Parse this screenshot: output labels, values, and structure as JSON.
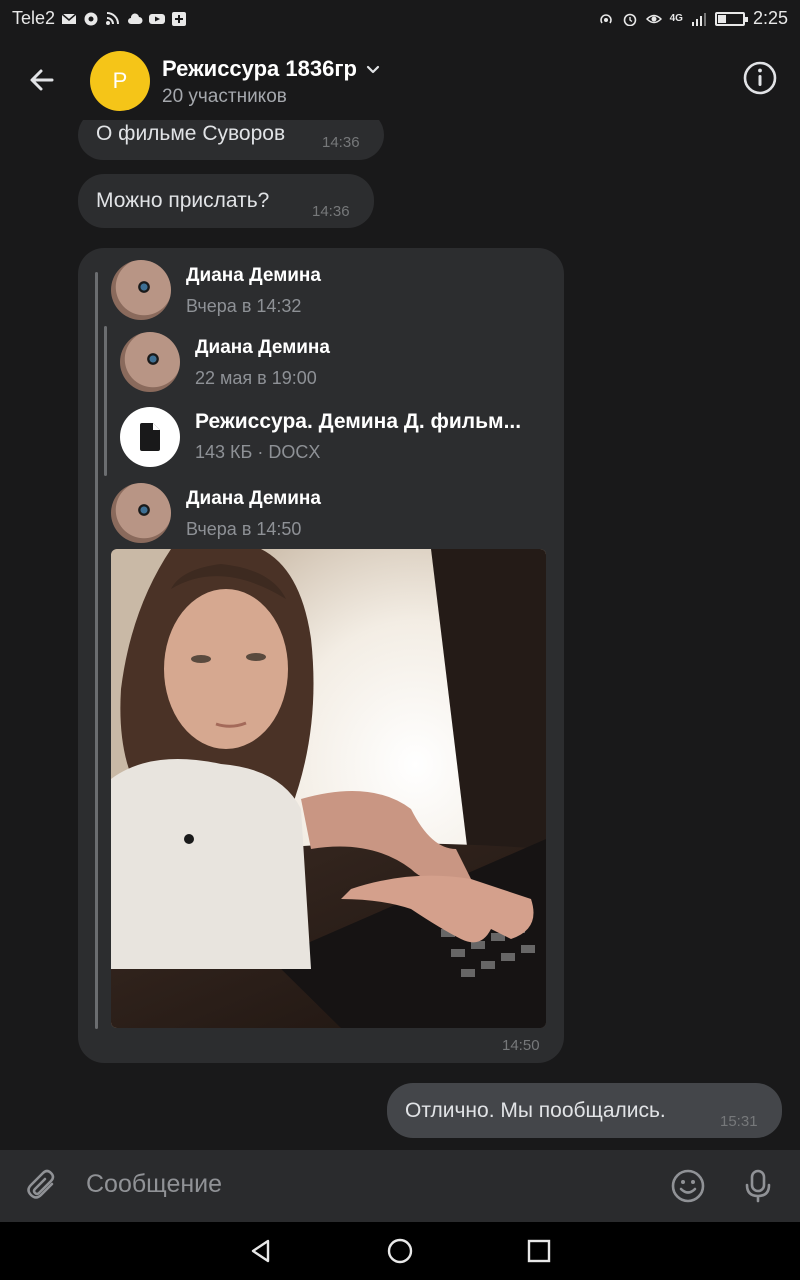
{
  "status_bar": {
    "carrier": "Tele2",
    "time": "2:25",
    "network": "4G",
    "battery_level": 0.35
  },
  "header": {
    "avatar_letter": "Р",
    "avatar_color": "#f5c518",
    "title": "Режиссура 1836гр",
    "subtitle": "20 участников"
  },
  "messages": [
    {
      "text": "О фильме Суворов",
      "time": "14:36"
    },
    {
      "text": "Можно прислать?",
      "time": "14:36"
    }
  ],
  "forwarded": {
    "author1": {
      "name": "Диана Демина",
      "date": "Вчера в 14:32"
    },
    "author2": {
      "name": "Диана Демина",
      "date": "22 мая в 19:00"
    },
    "document": {
      "title": "Режиссура. Демина Д.  фильм...",
      "meta": "143 КБ · DOCX"
    },
    "author3": {
      "name": "Диана Демина",
      "date": "Вчера в 14:50"
    },
    "time": "14:50"
  },
  "outgoing": {
    "text": "Отлично. Мы пообщались.",
    "time": "15:31"
  },
  "composer": {
    "placeholder": "Сообщение"
  },
  "icons": {
    "back": "arrow-left-icon",
    "info": "info-icon",
    "attach": "paperclip-icon",
    "emoji": "smile-icon",
    "mic": "microphone-icon"
  }
}
